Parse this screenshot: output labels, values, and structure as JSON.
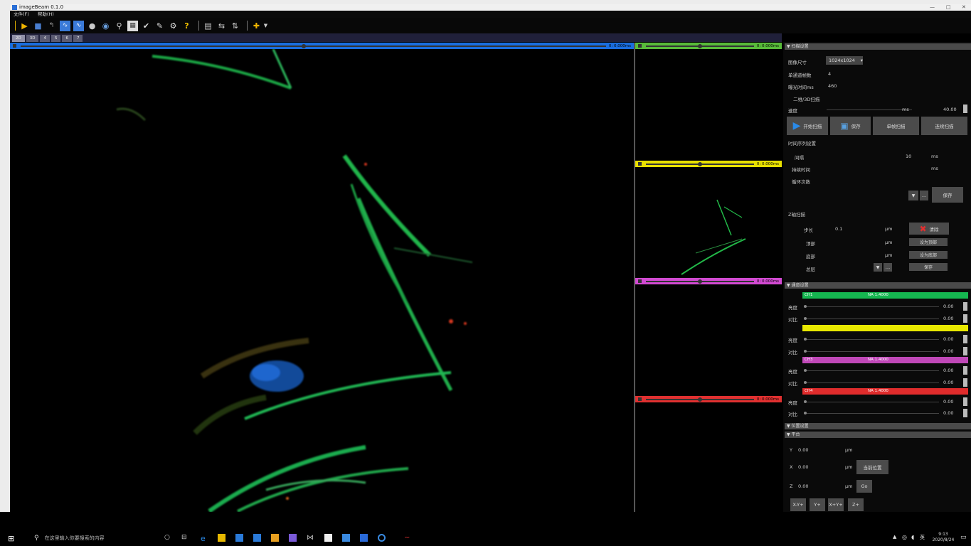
{
  "app": {
    "title": "imageBeam 0.1.0"
  },
  "menu": [
    "文件(F)",
    "帮助(H)"
  ],
  "toolbar_icons": [
    "open-folder-icon",
    "save-icon",
    "back-icon",
    "waveform-icon",
    "waveform2-icon",
    "record-icon",
    "sphere-icon",
    "zoom-icon",
    "image-icon",
    "pen-check-icon",
    "edit-icon",
    "settings-icon",
    "help-icon",
    "layout-icon",
    "flip-icon",
    "flip2-icon",
    "crosshair-icon",
    "dropdown-arrow-icon"
  ],
  "tabs": [
    "2D",
    "3D",
    "4",
    "5",
    "6",
    "7"
  ],
  "channels": [
    {
      "color": "#1a6ee0",
      "value": "0: 0.000ms"
    },
    {
      "color": "#58bc3a",
      "value": "0: 0.000ms"
    },
    {
      "color": "#e8e000",
      "value": "0: 0.000ms"
    },
    {
      "color": "#d24ad2",
      "value": "0: 0.000ms"
    },
    {
      "color": "#e03030",
      "value": "0: 0.000ms"
    }
  ],
  "acquire": {
    "header": "▼ 扫描设置",
    "size_label": "图像尺寸",
    "size_value": "1024x1024",
    "frames_label": "单通道帧数",
    "frames_value": "4",
    "ms_label": "曝光时间ms",
    "ms_value": "460",
    "continuous_label": "二维/3D扫描",
    "speed_label": "速度",
    "speed_value": "40.00",
    "speed_unit": "ms",
    "btn_start": "开始扫描",
    "btn_save": "保存",
    "btn_single": "单帧扫描",
    "btn_multi": "连续扫描"
  },
  "timelapse": {
    "header": "时间序列设置",
    "interval_label": "间隔",
    "interval_value": "10",
    "interval_unit": "ms",
    "duration_label": "持续时间",
    "duration_unit": "ms",
    "count_label": "循环次数",
    "btn": "保存"
  },
  "z": {
    "header": "Z轴扫描",
    "step_label": "步长",
    "step_value": "0.1",
    "top_label": "顶部",
    "bottom_label": "底部",
    "count_label": "总层",
    "unit": "μm",
    "btn_clear": "清除",
    "btn_top": "设为顶部",
    "btn_bottom": "设为底部",
    "btn_save": "保存"
  },
  "display": {
    "header": "▼ 通道设置",
    "strips": [
      {
        "label": "CH1",
        "value": "NA 1.4000",
        "color": "#15b650"
      },
      {
        "label": "",
        "value": "",
        "color": "#e8e800"
      },
      {
        "label": "CH3",
        "value": "NA 1.4000",
        "color": "#c048b8"
      },
      {
        "label": "CH4",
        "value": "NA 1.4000",
        "color": "#e02c2c"
      }
    ],
    "rows": [
      {
        "label": "亮度",
        "value": "0.00"
      },
      {
        "label": "对比",
        "value": "0.00"
      },
      {
        "label": "亮度",
        "value": "0.00"
      },
      {
        "label": "对比",
        "value": "0.00"
      },
      {
        "label": "亮度",
        "value": "0.00"
      },
      {
        "label": "对比",
        "value": "0.00"
      },
      {
        "label": "亮度",
        "value": "0.00"
      },
      {
        "label": "对比",
        "value": "0.00"
      }
    ]
  },
  "stage": {
    "header1": "▼ 位置设置",
    "header2": "▼ 平台",
    "y_label": "Y",
    "y_value": "0.00",
    "x_label": "X",
    "x_value": "0.00",
    "z_label": "Z",
    "z_value": "0.00",
    "unit": "μm",
    "btn_pos": "当前位置",
    "btn_go": "Go",
    "moves": [
      "X-Y+",
      "Y+",
      "X+Y+",
      "Z+"
    ]
  },
  "taskbar": {
    "search_placeholder": "在这里输入你要搜索的内容",
    "time": "9:13",
    "date": "2020/8/24",
    "lang": "英"
  }
}
